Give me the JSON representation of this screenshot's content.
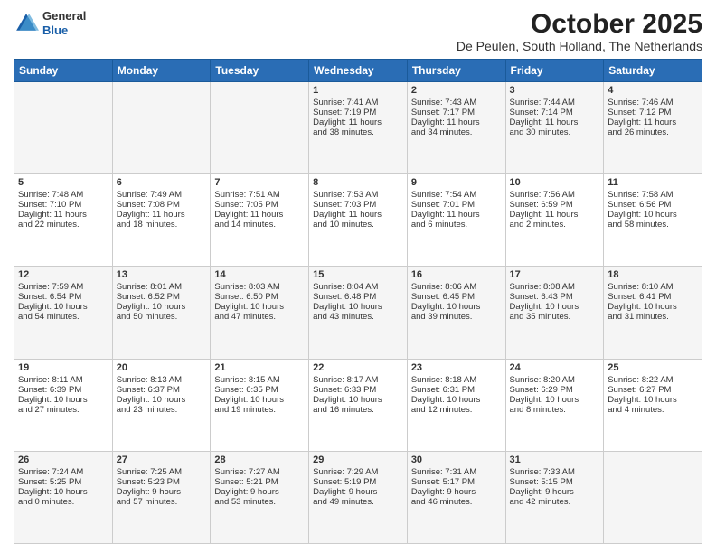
{
  "header": {
    "logo": {
      "line1": "General",
      "line2": "Blue"
    },
    "title": "October 2025",
    "subtitle": "De Peulen, South Holland, The Netherlands"
  },
  "days_of_week": [
    "Sunday",
    "Monday",
    "Tuesday",
    "Wednesday",
    "Thursday",
    "Friday",
    "Saturday"
  ],
  "weeks": [
    [
      {
        "day": "",
        "info": ""
      },
      {
        "day": "",
        "info": ""
      },
      {
        "day": "",
        "info": ""
      },
      {
        "day": "1",
        "info": "Sunrise: 7:41 AM\nSunset: 7:19 PM\nDaylight: 11 hours\nand 38 minutes."
      },
      {
        "day": "2",
        "info": "Sunrise: 7:43 AM\nSunset: 7:17 PM\nDaylight: 11 hours\nand 34 minutes."
      },
      {
        "day": "3",
        "info": "Sunrise: 7:44 AM\nSunset: 7:14 PM\nDaylight: 11 hours\nand 30 minutes."
      },
      {
        "day": "4",
        "info": "Sunrise: 7:46 AM\nSunset: 7:12 PM\nDaylight: 11 hours\nand 26 minutes."
      }
    ],
    [
      {
        "day": "5",
        "info": "Sunrise: 7:48 AM\nSunset: 7:10 PM\nDaylight: 11 hours\nand 22 minutes."
      },
      {
        "day": "6",
        "info": "Sunrise: 7:49 AM\nSunset: 7:08 PM\nDaylight: 11 hours\nand 18 minutes."
      },
      {
        "day": "7",
        "info": "Sunrise: 7:51 AM\nSunset: 7:05 PM\nDaylight: 11 hours\nand 14 minutes."
      },
      {
        "day": "8",
        "info": "Sunrise: 7:53 AM\nSunset: 7:03 PM\nDaylight: 11 hours\nand 10 minutes."
      },
      {
        "day": "9",
        "info": "Sunrise: 7:54 AM\nSunset: 7:01 PM\nDaylight: 11 hours\nand 6 minutes."
      },
      {
        "day": "10",
        "info": "Sunrise: 7:56 AM\nSunset: 6:59 PM\nDaylight: 11 hours\nand 2 minutes."
      },
      {
        "day": "11",
        "info": "Sunrise: 7:58 AM\nSunset: 6:56 PM\nDaylight: 10 hours\nand 58 minutes."
      }
    ],
    [
      {
        "day": "12",
        "info": "Sunrise: 7:59 AM\nSunset: 6:54 PM\nDaylight: 10 hours\nand 54 minutes."
      },
      {
        "day": "13",
        "info": "Sunrise: 8:01 AM\nSunset: 6:52 PM\nDaylight: 10 hours\nand 50 minutes."
      },
      {
        "day": "14",
        "info": "Sunrise: 8:03 AM\nSunset: 6:50 PM\nDaylight: 10 hours\nand 47 minutes."
      },
      {
        "day": "15",
        "info": "Sunrise: 8:04 AM\nSunset: 6:48 PM\nDaylight: 10 hours\nand 43 minutes."
      },
      {
        "day": "16",
        "info": "Sunrise: 8:06 AM\nSunset: 6:45 PM\nDaylight: 10 hours\nand 39 minutes."
      },
      {
        "day": "17",
        "info": "Sunrise: 8:08 AM\nSunset: 6:43 PM\nDaylight: 10 hours\nand 35 minutes."
      },
      {
        "day": "18",
        "info": "Sunrise: 8:10 AM\nSunset: 6:41 PM\nDaylight: 10 hours\nand 31 minutes."
      }
    ],
    [
      {
        "day": "19",
        "info": "Sunrise: 8:11 AM\nSunset: 6:39 PM\nDaylight: 10 hours\nand 27 minutes."
      },
      {
        "day": "20",
        "info": "Sunrise: 8:13 AM\nSunset: 6:37 PM\nDaylight: 10 hours\nand 23 minutes."
      },
      {
        "day": "21",
        "info": "Sunrise: 8:15 AM\nSunset: 6:35 PM\nDaylight: 10 hours\nand 19 minutes."
      },
      {
        "day": "22",
        "info": "Sunrise: 8:17 AM\nSunset: 6:33 PM\nDaylight: 10 hours\nand 16 minutes."
      },
      {
        "day": "23",
        "info": "Sunrise: 8:18 AM\nSunset: 6:31 PM\nDaylight: 10 hours\nand 12 minutes."
      },
      {
        "day": "24",
        "info": "Sunrise: 8:20 AM\nSunset: 6:29 PM\nDaylight: 10 hours\nand 8 minutes."
      },
      {
        "day": "25",
        "info": "Sunrise: 8:22 AM\nSunset: 6:27 PM\nDaylight: 10 hours\nand 4 minutes."
      }
    ],
    [
      {
        "day": "26",
        "info": "Sunrise: 7:24 AM\nSunset: 5:25 PM\nDaylight: 10 hours\nand 0 minutes."
      },
      {
        "day": "27",
        "info": "Sunrise: 7:25 AM\nSunset: 5:23 PM\nDaylight: 9 hours\nand 57 minutes."
      },
      {
        "day": "28",
        "info": "Sunrise: 7:27 AM\nSunset: 5:21 PM\nDaylight: 9 hours\nand 53 minutes."
      },
      {
        "day": "29",
        "info": "Sunrise: 7:29 AM\nSunset: 5:19 PM\nDaylight: 9 hours\nand 49 minutes."
      },
      {
        "day": "30",
        "info": "Sunrise: 7:31 AM\nSunset: 5:17 PM\nDaylight: 9 hours\nand 46 minutes."
      },
      {
        "day": "31",
        "info": "Sunrise: 7:33 AM\nSunset: 5:15 PM\nDaylight: 9 hours\nand 42 minutes."
      },
      {
        "day": "",
        "info": ""
      }
    ]
  ]
}
